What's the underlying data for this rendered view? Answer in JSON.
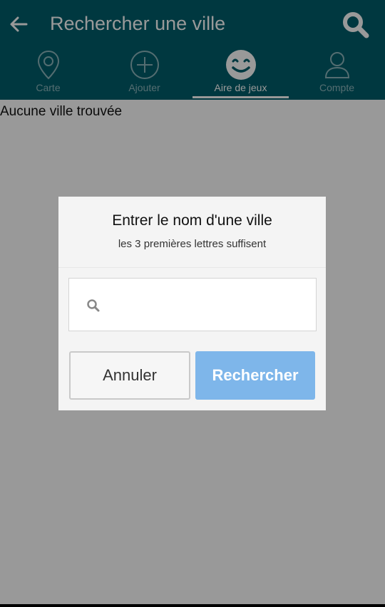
{
  "header": {
    "title": "Rechercher une ville",
    "back_icon": "arrow-left-icon",
    "search_icon": "search-icon"
  },
  "tabs": [
    {
      "label": "Carte",
      "icon": "map-pin-icon",
      "active": false
    },
    {
      "label": "Ajouter",
      "icon": "plus-circle-icon",
      "active": false
    },
    {
      "label": "Aire de jeux",
      "icon": "smiley-icon",
      "active": true
    },
    {
      "label": "Compte",
      "icon": "user-icon",
      "active": false
    }
  ],
  "main": {
    "empty_message": "Aucune ville trouvée"
  },
  "dialog": {
    "title": "Entrer le nom d'une ville",
    "subtitle": "les 3 premières lettres suffisent",
    "search_value": "",
    "cancel_label": "Annuler",
    "search_label": "Rechercher"
  },
  "colors": {
    "header": "#005e6b",
    "primary_button": "#7eb6ea",
    "overlay": "#9a9a9a"
  }
}
